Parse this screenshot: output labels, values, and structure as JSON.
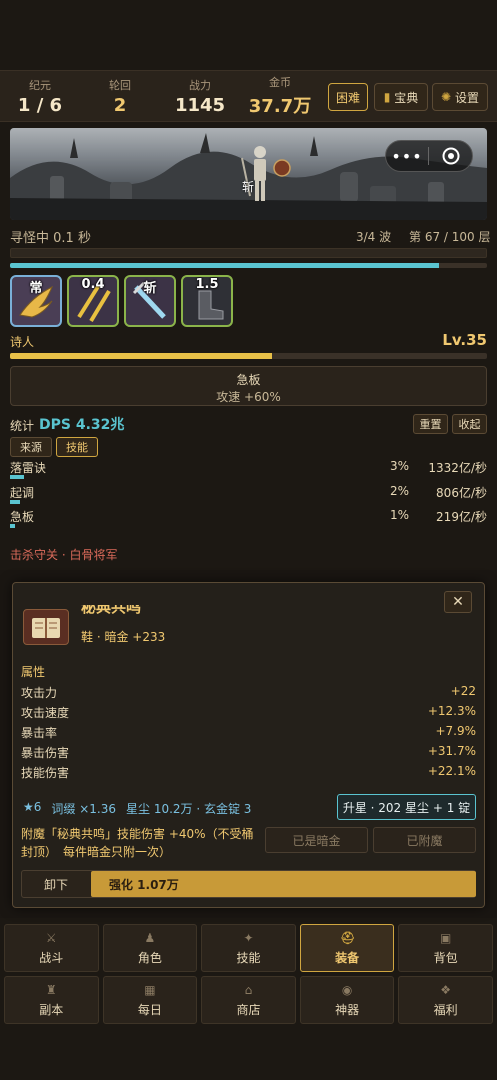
{
  "stats": [
    {
      "label": "纪元",
      "value": "1 / 6"
    },
    {
      "label": "轮回",
      "value": "2"
    },
    {
      "label": "战力",
      "value": "1145"
    },
    {
      "label": "金币",
      "value": "37.7万"
    }
  ],
  "top_buttons": {
    "difficulty": "困难",
    "codex": "宝典",
    "settings": "设置"
  },
  "capsule": {
    "menu": "•••"
  },
  "scene": {
    "floating_text": "斩"
  },
  "status": {
    "searching": "寻怪中 0.1 秒",
    "wave": "3/4 波",
    "floor": "第 67 / 100 层",
    "wave_progress": 0.9
  },
  "skills": [
    {
      "tag": "常",
      "icon": "wing-icon"
    },
    {
      "tag": "0.4",
      "icon": "swords-icon"
    },
    {
      "tag": "斩",
      "icon": "blade-icon"
    },
    {
      "tag": "1.5",
      "icon": "boot-icon"
    }
  ],
  "hero": {
    "class_name": "诗人",
    "level": "Lv.35",
    "exp_progress": 0.55
  },
  "buff": {
    "name": "急板",
    "desc": "攻速 +60%"
  },
  "dps": {
    "label": "统计",
    "value": "DPS 4.32兆",
    "reset": "重置",
    "collapse": "收起",
    "tab_source": "来源",
    "tab_skill": "技能",
    "rows": [
      {
        "name": "落雷诀",
        "pct": "3%",
        "amount": "1332亿/秒",
        "bar": 0.03
      },
      {
        "name": "起调",
        "pct": "2%",
        "amount": "806亿/秒",
        "bar": 0.02
      },
      {
        "name": "急板",
        "pct": "1%",
        "amount": "219亿/秒",
        "bar": 0.01
      }
    ]
  },
  "kill_notice": "击杀守关 · 白骨将军",
  "item": {
    "title": "秘典共鸣",
    "subtitle": "鞋 · 暗金 +233",
    "attr_header": "属性",
    "attrs": [
      {
        "k": "攻击力",
        "v": "+22"
      },
      {
        "k": "攻击速度",
        "v": "+12.3%"
      },
      {
        "k": "暴击率",
        "v": "+7.9%"
      },
      {
        "k": "暴击伤害",
        "v": "+31.7%"
      },
      {
        "k": "技能伤害",
        "v": "+22.1%"
      }
    ],
    "star_line": {
      "star": "★6",
      "affix": "词缀 ×1.36",
      "dust": "星尘 10.2万 · 玄金锭 3"
    },
    "upgrade_star": "升星 · 202 星尘 + 1 锭",
    "enchant_text": "附魔「秘典共鸣」技能伤害 +40%（不受桶封顶）　每件暗金只附一次）",
    "btn_already_dark": "已是暗金",
    "btn_enchanted": "已附魔",
    "btn_unequip": "卸下",
    "btn_enhance": "强化 1.07万"
  },
  "nav_row1": [
    {
      "label": "战斗",
      "icon": "swords-icon"
    },
    {
      "label": "角色",
      "icon": "person-icon"
    },
    {
      "label": "技能",
      "icon": "skill-icon"
    },
    {
      "label": "装备",
      "icon": "helmet-icon"
    },
    {
      "label": "背包",
      "icon": "bag-icon"
    }
  ],
  "nav_row2": [
    {
      "label": "副本",
      "icon": "castle-icon"
    },
    {
      "label": "每日",
      "icon": "calendar-icon"
    },
    {
      "label": "商店",
      "icon": "shop-icon"
    },
    {
      "label": "神器",
      "icon": "artifact-icon"
    },
    {
      "label": "福利",
      "icon": "gift-icon"
    }
  ],
  "colors": {
    "accent": "#f0c870",
    "cyan": "#5ac4d0",
    "red_notice": "#d96a5a"
  }
}
